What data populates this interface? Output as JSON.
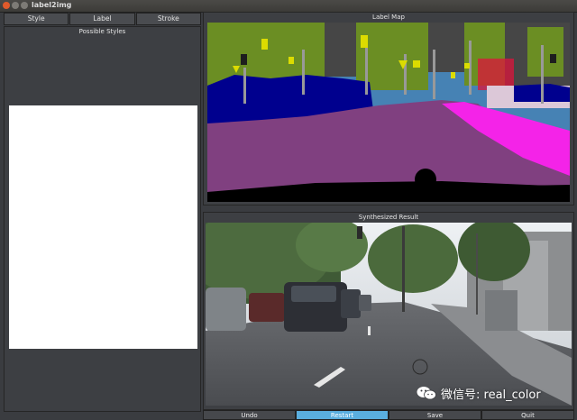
{
  "window": {
    "title": "label2img"
  },
  "tabs": [
    "Style",
    "Label",
    "Stroke"
  ],
  "styles_panel": {
    "title": "Possible Styles"
  },
  "label_map": {
    "title": "Label Map"
  },
  "result": {
    "title": "Synthesized Result"
  },
  "buttons": {
    "undo": "Undo",
    "restart": "Restart",
    "save": "Save",
    "quit": "Quit"
  },
  "watermark": {
    "text": "微信号: real_color"
  },
  "colors": {
    "accent": "#5aaede",
    "label_road": "#804080",
    "label_sidewalk": "#f423e8",
    "label_car": "#00008e",
    "label_sky": "#4682b4",
    "label_vegetation": "#6b8e23",
    "label_building": "#464646",
    "label_sign": "#dcdc00",
    "label_pole": "#999999"
  }
}
